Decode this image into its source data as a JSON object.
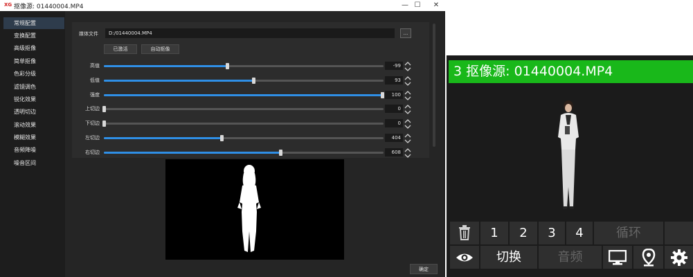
{
  "window": {
    "logo": "XG",
    "title": "抠像源: 01440004.MP4",
    "controls": {
      "minimize": "—",
      "maximize": "☐",
      "close": "✕"
    }
  },
  "sidebar": {
    "items": [
      {
        "label": "常规配置",
        "active": true
      },
      {
        "label": "变换配置"
      },
      {
        "label": "高级抠像"
      },
      {
        "label": "简单抠像"
      },
      {
        "label": "色彩分级"
      },
      {
        "label": "滤镜调色"
      },
      {
        "label": "锐化效果"
      },
      {
        "label": "透明切边"
      },
      {
        "label": "滚动效果"
      },
      {
        "label": "模糊效果"
      },
      {
        "label": "音频降噪"
      },
      {
        "label": "噪音区间"
      }
    ]
  },
  "settings": {
    "media_label": "媒体文件",
    "media_value": "D:/01440004.MP4",
    "browse_label": "...",
    "activated_label": "已激活",
    "auto_key_label": "自动抠像",
    "sliders": [
      {
        "label": "高值",
        "value": "-99",
        "fraction": 0.44
      },
      {
        "label": "低值",
        "value": "93",
        "fraction": 0.535
      },
      {
        "label": "强度",
        "value": "100",
        "fraction": 0.995
      },
      {
        "label": "上切边",
        "value": "0",
        "fraction": 0.0
      },
      {
        "label": "下切边",
        "value": "0",
        "fraction": 0.0
      },
      {
        "label": "左切边",
        "value": "404",
        "fraction": 0.42
      },
      {
        "label": "右切边",
        "value": "608",
        "fraction": 0.63
      }
    ],
    "ok_label": "确定"
  },
  "monitor": {
    "title": "3 抠像源: 01440004.MP4",
    "row1": [
      "1",
      "2",
      "3",
      "4",
      "循环"
    ],
    "row2": [
      "切换",
      "音频"
    ]
  },
  "colors": {
    "accent": "#2f8fe6",
    "green": "#19b81a",
    "sidebar_active": "#2e3c4c"
  }
}
